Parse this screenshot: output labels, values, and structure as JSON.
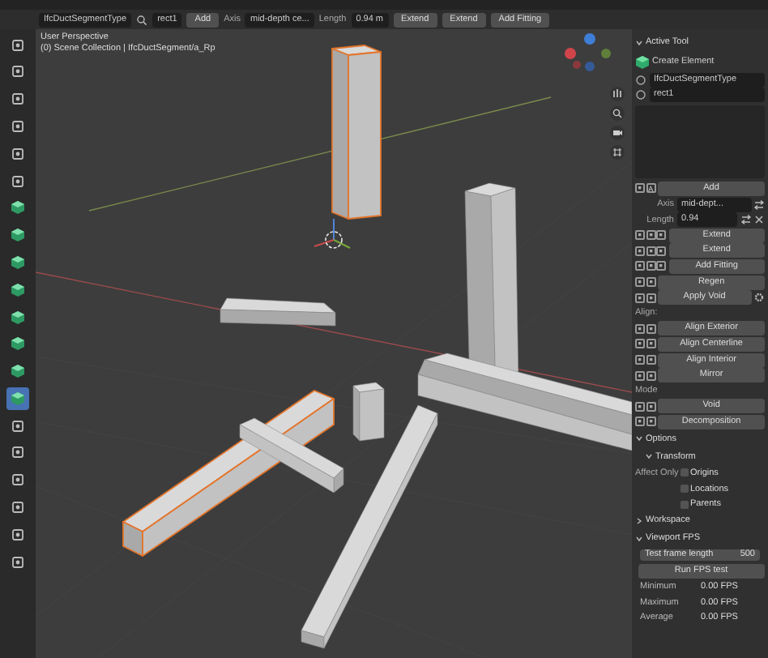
{
  "header": {
    "type_dropdown": "IfcDuctSegmentType",
    "name_dropdown": "rect1",
    "add_button": "Add",
    "axis_label": "Axis",
    "axis_value": "mid-depth ce...",
    "length_label": "Length",
    "length_value": "0.94 m",
    "extend_buttons": [
      "Extend",
      "Extend"
    ],
    "fitting_button": "Add Fitting"
  },
  "toolbar": [
    {
      "selected": false
    },
    {
      "selected": false
    },
    {
      "selected": false
    },
    {
      "selected": false
    },
    {
      "selected": false
    },
    {
      "selected": false
    },
    {
      "selected": false
    },
    {
      "selected": false
    },
    {
      "selected": false
    },
    {
      "selected": false
    },
    {
      "selected": false
    },
    {
      "selected": false
    },
    {
      "selected": false
    },
    {
      "selected": true
    },
    {
      "selected": false
    },
    {
      "selected": false
    },
    {
      "selected": false
    },
    {
      "selected": false
    },
    {
      "selected": false
    },
    {
      "selected": false
    }
  ],
  "viewport": {
    "title": "User Perspective",
    "collection": "(0) Scene Collection | IfcDuctSegment/a_Rp",
    "objects": [
      {
        "selected": true
      },
      {
        "selected": false
      },
      {
        "selected": false
      },
      {
        "selected": false
      },
      {
        "selected": false
      },
      {
        "selected": true
      },
      {
        "selected": false
      },
      {
        "selected": false
      }
    ]
  },
  "panel": [
    {
      "kind": "section",
      "label": "Active Tool",
      "expanded": true
    },
    {
      "kind": "tool",
      "label": "Create Element"
    },
    {
      "kind": "dropdown",
      "label": "IfcDuctSegmentType"
    },
    {
      "kind": "dropdown",
      "label": "rect1"
    },
    {
      "kind": "listbox"
    },
    {
      "kind": "button",
      "label": "Add",
      "keys": [
        {
          "kind": "toggle"
        },
        {
          "kind": "letter",
          "text": "A"
        }
      ]
    },
    {
      "kind": "prop",
      "label": "Axis",
      "value": "mid-dept...",
      "icons": [
        {
          "kind": "swap"
        }
      ]
    },
    {
      "kind": "prop",
      "label": "Length",
      "value": "0.94",
      "icons": [
        {
          "kind": "swap"
        },
        {
          "kind": "close"
        }
      ]
    },
    {
      "kind": "button",
      "label": "Extend",
      "keys": [
        {
          "kind": "toggle"
        },
        {
          "kind": "toggle"
        },
        {
          "kind": "toggle"
        }
      ]
    },
    {
      "kind": "button",
      "label": "Extend",
      "keys": [
        {
          "kind": "toggle"
        },
        {
          "kind": "toggle"
        },
        {
          "kind": "toggle"
        }
      ]
    },
    {
      "kind": "button",
      "label": "Add Fitting",
      "keys": [
        {
          "kind": "toggle"
        },
        {
          "kind": "toggle"
        },
        {
          "kind": "toggle"
        }
      ]
    },
    {
      "kind": "button",
      "label": "Regen",
      "keys": [
        {
          "kind": "toggle"
        },
        {
          "kind": "toggle"
        }
      ]
    },
    {
      "kind": "button",
      "label": "Apply Void",
      "keys": [
        {
          "kind": "toggle"
        },
        {
          "kind": "toggle"
        }
      ],
      "trailing_icon": true
    },
    {
      "kind": "label",
      "label": "Align:"
    },
    {
      "kind": "button",
      "label": "Align Exterior",
      "keys": [
        {
          "kind": "toggle"
        },
        {
          "kind": "toggle"
        }
      ]
    },
    {
      "kind": "button",
      "label": "Align Centerline",
      "keys": [
        {
          "kind": "toggle"
        },
        {
          "kind": "toggle"
        }
      ]
    },
    {
      "kind": "button",
      "label": "Align Interior",
      "keys": [
        {
          "kind": "toggle"
        },
        {
          "kind": "toggle"
        }
      ]
    },
    {
      "kind": "button",
      "label": "Mirror",
      "keys": [
        {
          "kind": "toggle"
        },
        {
          "kind": "toggle"
        }
      ]
    },
    {
      "kind": "label",
      "label": "Mode"
    },
    {
      "kind": "button",
      "label": "Void",
      "keys": [
        {
          "kind": "toggle"
        },
        {
          "kind": "toggle"
        }
      ]
    },
    {
      "kind": "button",
      "label": "Decomposition",
      "keys": [
        {
          "kind": "toggle"
        },
        {
          "kind": "toggle"
        }
      ]
    },
    {
      "kind": "section",
      "label": "Options",
      "expanded": true
    },
    {
      "kind": "subsection",
      "label": "Transform",
      "expanded": true
    },
    {
      "kind": "checkbox",
      "prefix": "Affect Only",
      "label": "Origins",
      "checked": false
    },
    {
      "kind": "checkbox",
      "label": "Locations",
      "checked": false
    },
    {
      "kind": "checkbox",
      "label": "Parents",
      "checked": false
    },
    {
      "kind": "section",
      "label": "Workspace",
      "expanded": false
    },
    {
      "kind": "section",
      "label": "Viewport FPS",
      "expanded": true
    },
    {
      "kind": "field",
      "label": "Test frame length",
      "value": "500"
    },
    {
      "kind": "button",
      "label": "Run FPS test"
    },
    {
      "kind": "stat",
      "label": "Minimum",
      "value": "0.00 FPS"
    },
    {
      "kind": "stat",
      "label": "Maximum",
      "value": "0.00 FPS"
    },
    {
      "kind": "stat",
      "label": "Average",
      "value": "0.00 FPS"
    }
  ]
}
